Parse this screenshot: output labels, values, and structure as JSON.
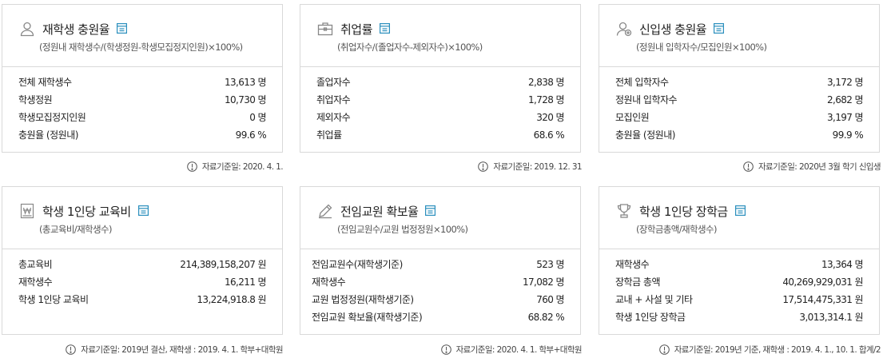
{
  "cards": [
    {
      "icon": "person-icon",
      "title": "재학생 충원율",
      "formula": "(정원내 재학생수/(학생정원-학생모집정지인원)×100%)",
      "rows": [
        {
          "label": "전체 재학생수",
          "value": "13,613 명"
        },
        {
          "label": "학생정원",
          "value": "10,730 명"
        },
        {
          "label": "학생모집정지인원",
          "value": "0 명"
        },
        {
          "label": "충원율 (정원내)",
          "value": "99.6 %"
        }
      ],
      "source": "자료기준일: 2020. 4. 1."
    },
    {
      "icon": "briefcase-icon",
      "title": "취업률",
      "formula": "(취업자수/(졸업자수-제외자수)×100%)",
      "rows": [
        {
          "label": "졸업자수",
          "value": "2,838 명"
        },
        {
          "label": "취업자수",
          "value": "1,728 명"
        },
        {
          "label": "제외자수",
          "value": "320 명"
        },
        {
          "label": "취업률",
          "value": "68.6 %"
        }
      ],
      "source": "자료기준일: 2019. 12. 31"
    },
    {
      "icon": "user-add-icon",
      "title": "신입생 충원율",
      "formula": "(정원내 입학자수/모집인원×100%)",
      "rows": [
        {
          "label": "전체 입학자수",
          "value": "3,172 명"
        },
        {
          "label": "정원내 입학자수",
          "value": "2,682 명"
        },
        {
          "label": "모집인원",
          "value": "3,197 명"
        },
        {
          "label": "충원율 (정원내)",
          "value": "99.9 %"
        }
      ],
      "source": "자료기준일: 2020년 3월 학기 신입생"
    },
    {
      "icon": "won-icon",
      "title": "학생 1인당 교육비",
      "formula": "(총교육비/재학생수)",
      "rows": [
        {
          "label": "총교육비",
          "value": "214,389,158,207 원"
        },
        {
          "label": "재학생수",
          "value": "16,211 명"
        },
        {
          "label": "학생 1인당 교육비",
          "value": "13,224,918.8 원"
        }
      ],
      "source": "자료기준일: 2019년 결산, 재학생 : 2019. 4. 1. 학부+대학원"
    },
    {
      "icon": "pencil-icon",
      "title": "전임교원 확보율",
      "formula": "(전임교원수/교원 법정정원×100%)",
      "rows": [
        {
          "label": "전임교원수(재학생기준)",
          "value": "523 명"
        },
        {
          "label": "재학생수",
          "value": "17,082 명"
        },
        {
          "label": "교원 법정정원(재학생기준)",
          "value": "760 명"
        },
        {
          "label": "전임교원 확보율(재학생기준)",
          "value": "68.82 %"
        }
      ],
      "source": "자료기준일: 2020. 4. 1. 학부+대학원"
    },
    {
      "icon": "trophy-icon",
      "title": "학생 1인당 장학금",
      "formula": "(장학금총액/재학생수)",
      "rows": [
        {
          "label": "재학생수",
          "value": "13,364 명"
        },
        {
          "label": "장학금 총액",
          "value": "40,269,929,031 원"
        },
        {
          "label": "교내 + 사설 및 기타",
          "value": "17,514,475,331 원"
        },
        {
          "label": "학생 1인당 장학금",
          "value": "3,013,314.1 원"
        }
      ],
      "source": "자료기준일: 2019년 기준, 재학생 : 2019. 4. 1., 10. 1. 합계/2"
    }
  ]
}
